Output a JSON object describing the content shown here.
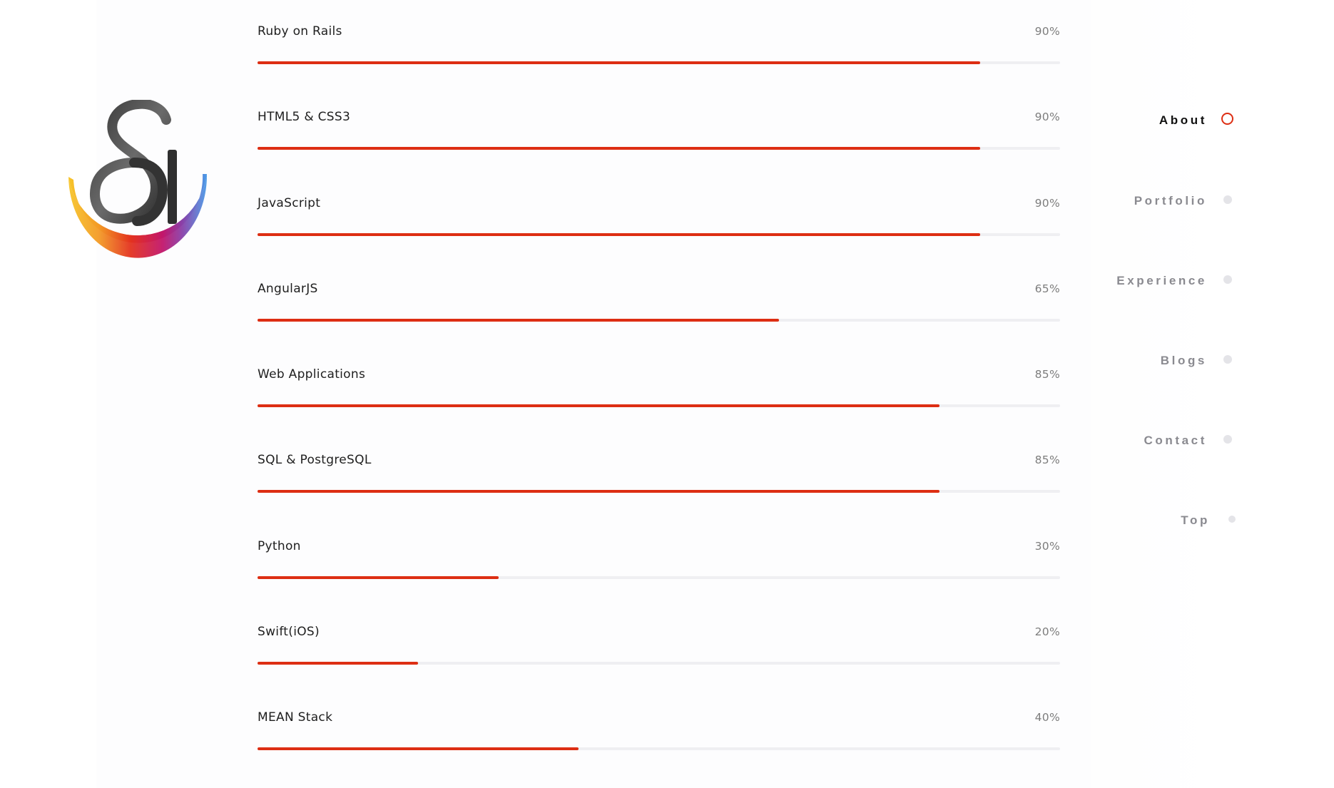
{
  "colors": {
    "accent": "#dd2e13",
    "track": "#efeff2",
    "nav_inactive": "#8a8a90",
    "nav_active": "#111111"
  },
  "logo": {
    "icon": "ampersand-logo-icon"
  },
  "skills": [
    {
      "name": "Ruby on Rails",
      "percent_label": "90%",
      "level": 0.9
    },
    {
      "name": "HTML5 & CSS3",
      "percent_label": "90%",
      "level": 0.9
    },
    {
      "name": "JavaScript",
      "percent_label": "90%",
      "level": 0.9
    },
    {
      "name": "AngularJS",
      "percent_label": "65%",
      "level": 0.65
    },
    {
      "name": "Web Applications",
      "percent_label": "85%",
      "level": 0.85
    },
    {
      "name": "SQL & PostgreSQL",
      "percent_label": "85%",
      "level": 0.85
    },
    {
      "name": "Python",
      "percent_label": "30%",
      "level": 0.3
    },
    {
      "name": "Swift(iOS)",
      "percent_label": "20%",
      "level": 0.2
    },
    {
      "name": "MEAN Stack",
      "percent_label": "40%",
      "level": 0.4
    }
  ],
  "nav": {
    "items": [
      {
        "label": "About",
        "active": true
      },
      {
        "label": "Portfolio",
        "active": false
      },
      {
        "label": "Experience",
        "active": false
      },
      {
        "label": "Blogs",
        "active": false
      },
      {
        "label": "Contact",
        "active": false
      },
      {
        "label": "Top",
        "active": false
      }
    ]
  }
}
